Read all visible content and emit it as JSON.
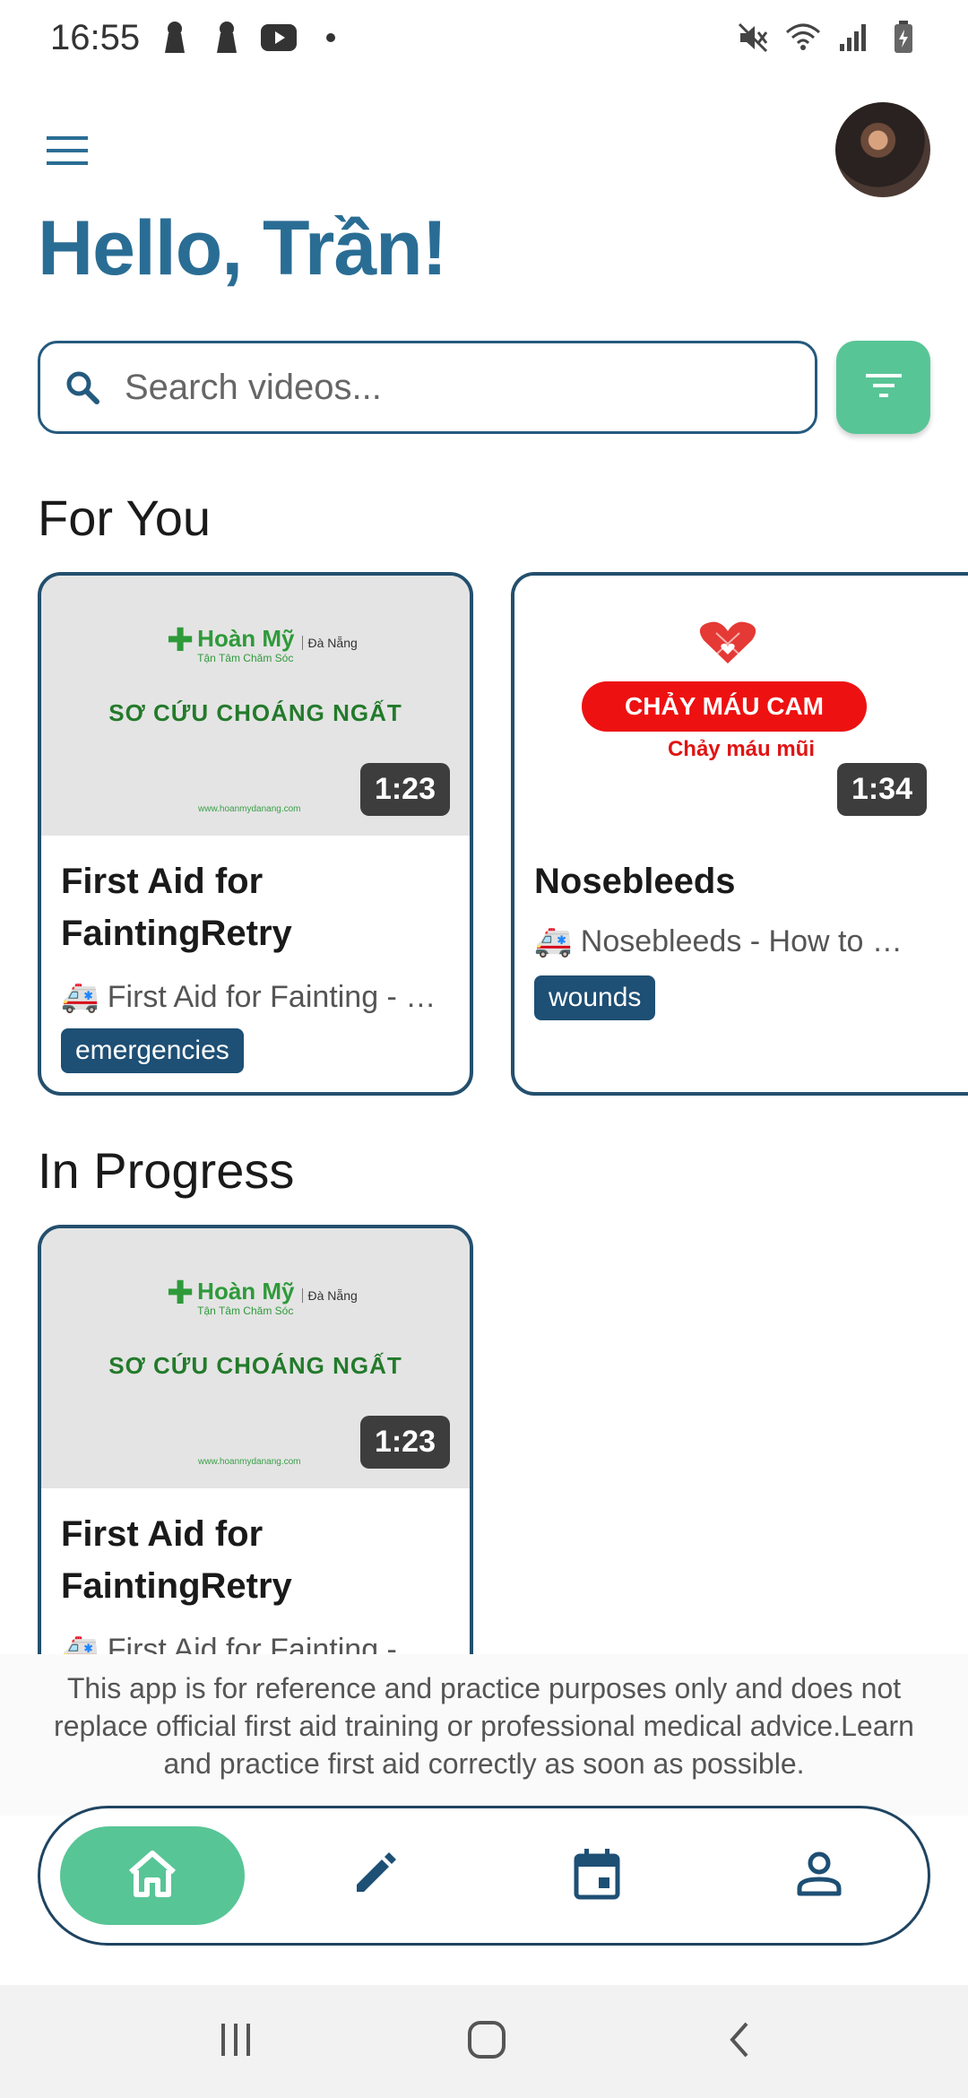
{
  "status_bar": {
    "time": "16:55",
    "left_icons": [
      "keyhole-icon",
      "keyhole-icon",
      "youtube-icon",
      "dot-icon"
    ],
    "right_icons": [
      "mute-icon",
      "wifi-icon",
      "signal-icon",
      "battery-icon"
    ]
  },
  "header": {
    "greeting": "Hello, Trần!"
  },
  "search": {
    "placeholder": "Search videos..."
  },
  "sections": {
    "for_you": "For You",
    "in_progress": "In Progress"
  },
  "for_you_cards": [
    {
      "title": "First Aid for FaintingRetry",
      "description": "🚑 First Aid for Fainting - …",
      "duration": "1:23",
      "tag": "emergencies",
      "thumb": {
        "brand": "Hoàn Mỹ",
        "brand_sub": "Tận Tâm Chăm Sóc",
        "city": "Đà Nẵng",
        "headline": "SƠ CỨU CHOÁNG NGẤT",
        "url": "www.hoanmydanang.com"
      }
    },
    {
      "title": "Nosebleeds",
      "description": "🚑 Nosebleeds - How to …",
      "duration": "1:34",
      "tag": "wounds",
      "thumb": {
        "headline": "CHẢY MÁU CAM",
        "subline": "Chảy máu mũi"
      }
    }
  ],
  "in_progress_cards": [
    {
      "title": "First Aid for FaintingRetry",
      "description": "🚑 First Aid for Fainting - …",
      "duration": "1:23",
      "thumb": {
        "brand": "Hoàn Mỹ",
        "brand_sub": "Tận Tâm Chăm Sóc",
        "city": "Đà Nẵng",
        "headline": "SƠ CỨU CHOÁNG NGẤT",
        "url": "www.hoanmydanang.com"
      }
    }
  ],
  "disclaimer": "This app is for reference and practice purposes only and does not replace official first aid training or professional medical advice.Learn and practice first aid correctly as soon as possible.",
  "bottom_nav": [
    {
      "icon": "home-icon",
      "active": true
    },
    {
      "icon": "edit-icon",
      "active": false
    },
    {
      "icon": "calendar-icon",
      "active": false
    },
    {
      "icon": "profile-icon",
      "active": false
    }
  ],
  "colors": {
    "primary": "#2a6d94",
    "accent_green": "#58c596",
    "card_border": "#244f6e",
    "tag_bg": "#1e4f74"
  }
}
